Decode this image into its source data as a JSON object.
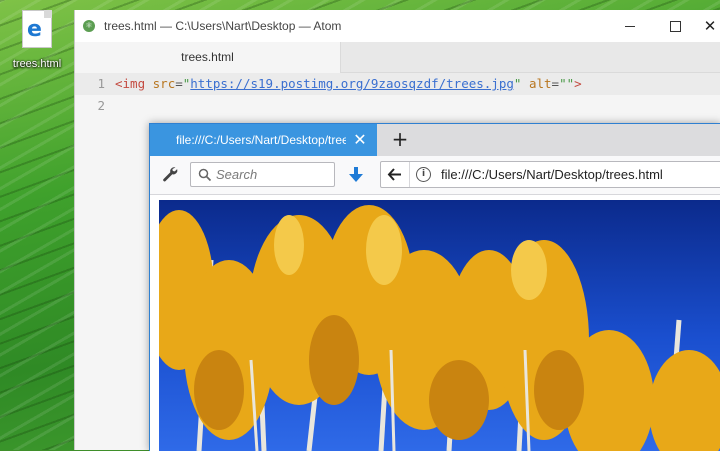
{
  "desktop": {
    "icon": {
      "label": "trees.html",
      "glyph": "e",
      "icon_name": "edge-html-file-icon"
    }
  },
  "atom": {
    "title": "trees.html — C:\\Users\\Nart\\Desktop — Atom",
    "tab_label": "trees.html",
    "lines": [
      {
        "number": "1",
        "tag_open": "<img",
        "attr1": "src",
        "url": "https://s19.postimg.org/9zaosqzdf/trees.jpg",
        "attr2": "alt",
        "empty": "\"\"",
        "tag_close": ">"
      },
      {
        "number": "2"
      }
    ]
  },
  "firefox": {
    "tab_title": "file:///C:/Users/Nart/Desktop/trees.html",
    "search_placeholder": "Search",
    "url": "file:///C:/Users/Nart/Desktop/trees.html",
    "accent": "#3a95e0"
  },
  "colors": {
    "sky": "#1a4fcf",
    "foliage": "#e8a818",
    "trunk": "#e9e6dc"
  }
}
